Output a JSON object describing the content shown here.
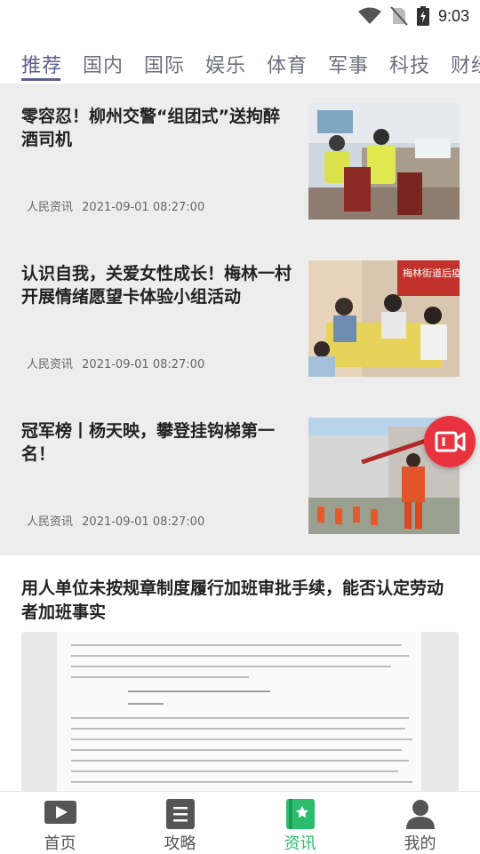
{
  "status_bar": {
    "time": "9:03"
  },
  "tabs": [
    {
      "label": "推荐",
      "active": true
    },
    {
      "label": "国内"
    },
    {
      "label": "国际"
    },
    {
      "label": "娱乐"
    },
    {
      "label": "体育"
    },
    {
      "label": "军事"
    },
    {
      "label": "科技"
    },
    {
      "label": "财经"
    }
  ],
  "news": [
    {
      "title": "零容忍！柳州交警“组团式”送拘醉酒司机",
      "source": "人民资讯",
      "time": "2021-09-01 08:27:00"
    },
    {
      "title": "认识自我，关爱女性成长！梅林一村开展情绪愿望卡体验小组活动",
      "source": "人民资讯",
      "time": "2021-09-01 08:27:00",
      "image_text": "梅林街道后疫"
    },
    {
      "title": "冠军榜丨杨天映，攀登挂钩梯第一名！",
      "source": "人民资讯",
      "time": "2021-09-01 08:27:00"
    }
  ],
  "featured": {
    "title": "用人单位未按规章制度履行加班审批手续，能否认定劳动者加班事实"
  },
  "bottom_nav": [
    {
      "label": "首页",
      "icon": "video-icon"
    },
    {
      "label": "攻略",
      "icon": "document-icon"
    },
    {
      "label": "资讯",
      "icon": "news-bookmark-icon",
      "active": true
    },
    {
      "label": "我的",
      "icon": "person-icon"
    }
  ],
  "colors": {
    "accent_tab": "#5c5e8c",
    "active_nav": "#2bbd6c",
    "fab": "#e8333e"
  }
}
